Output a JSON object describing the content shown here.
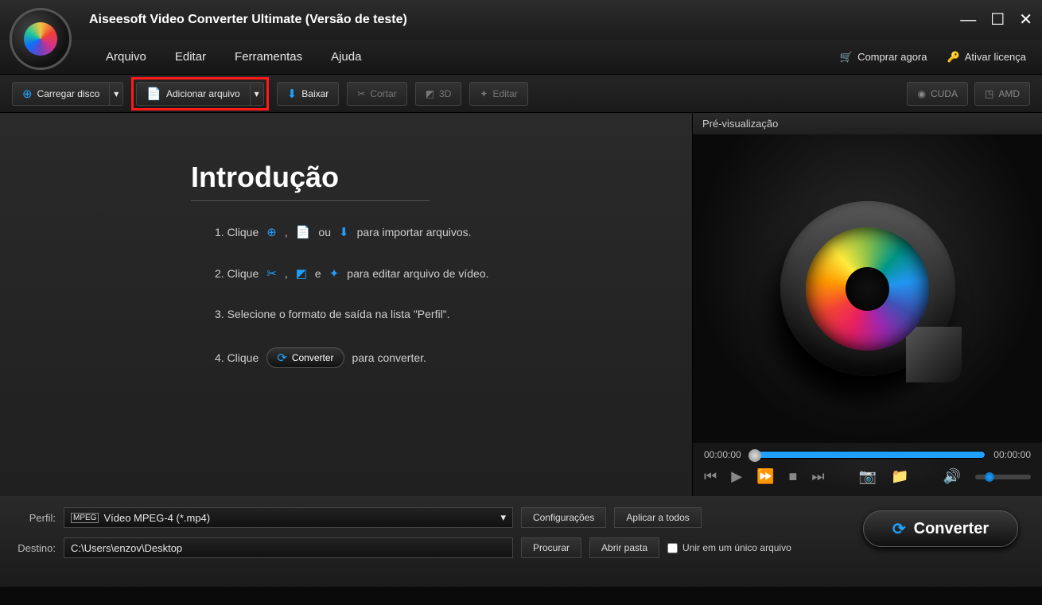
{
  "title": "Aiseesoft Video Converter Ultimate (Versão de teste)",
  "menu": {
    "arquivo": "Arquivo",
    "editar": "Editar",
    "ferramentas": "Ferramentas",
    "ajuda": "Ajuda",
    "comprar": "Comprar agora",
    "ativar": "Ativar licença"
  },
  "toolbar": {
    "carregar": "Carregar disco",
    "adicionar": "Adicionar arquivo",
    "baixar": "Baixar",
    "cortar": "Cortar",
    "threeD": "3D",
    "editar": "Editar",
    "cuda": "CUDA",
    "amd": "AMD"
  },
  "intro": {
    "heading": "Introdução",
    "step1_pre": "1. Clique",
    "step1_ou": "ou",
    "step1_post": "para importar arquivos.",
    "step2_pre": "2. Clique",
    "step2_e": "e",
    "step2_post": "para editar arquivo de vídeo.",
    "step3": "3. Selecione o formato de saída na lista \"Perfil\".",
    "step4_pre": "4. Clique",
    "step4_convert": "Converter",
    "step4_post": "para converter."
  },
  "preview": {
    "label": "Pré-visualização",
    "timeStart": "00:00:00",
    "timeEnd": "00:00:00"
  },
  "bottom": {
    "perfil_label": "Perfil:",
    "perfil_value": "Vídeo MPEG-4 (*.mp4)",
    "destino_label": "Destino:",
    "destino_value": "C:\\Users\\enzov\\Desktop",
    "config": "Configurações",
    "aplicar": "Aplicar a todos",
    "procurar": "Procurar",
    "abrir": "Abrir pasta",
    "merge": "Unir em um único arquivo",
    "convert": "Converter"
  }
}
